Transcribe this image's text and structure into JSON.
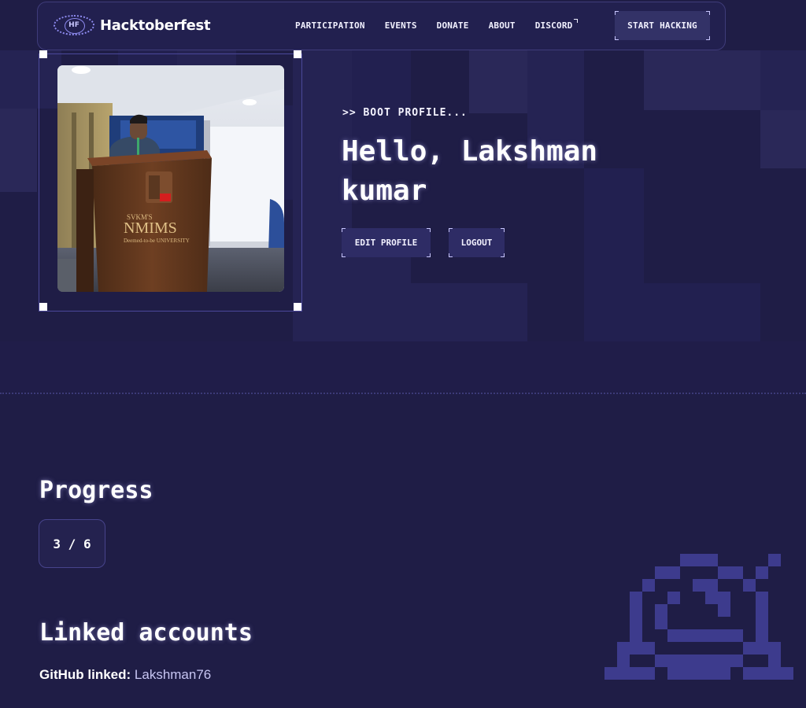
{
  "brand": {
    "logo_badge": "HF",
    "name": "Hacktoberfest"
  },
  "nav": {
    "links": [
      {
        "label": "PARTICIPATION",
        "external": false
      },
      {
        "label": "EVENTS",
        "external": false
      },
      {
        "label": "DONATE",
        "external": false
      },
      {
        "label": "ABOUT",
        "external": false
      },
      {
        "label": "DISCORD",
        "external": true
      }
    ],
    "cta_label": "START HACKING"
  },
  "profile": {
    "boot_text": ">> BOOT PROFILE...",
    "greeting": "Hello, Lakshman kumar",
    "edit_label": "EDIT PROFILE",
    "logout_label": "LOGOUT",
    "photo_signage": {
      "line1": "SVKM'S",
      "line2": "NMIMS",
      "line3": "Deemed-to-be UNIVERSITY"
    }
  },
  "progress": {
    "heading": "Progress",
    "value": "3 / 6"
  },
  "linked_accounts": {
    "heading": "Linked accounts",
    "github_label": "GitHub linked:",
    "github_user": "Lakshman76"
  },
  "colors": {
    "background": "#1f1d46",
    "nav_bg": "#23214f",
    "button_bg": "#333267",
    "accent": "#3b3a86",
    "text": "#f2f1ff"
  },
  "icons": {
    "logo": "globe-logo-icon",
    "external": "external-link-icon",
    "decoration": "pixel-robot-icon"
  }
}
